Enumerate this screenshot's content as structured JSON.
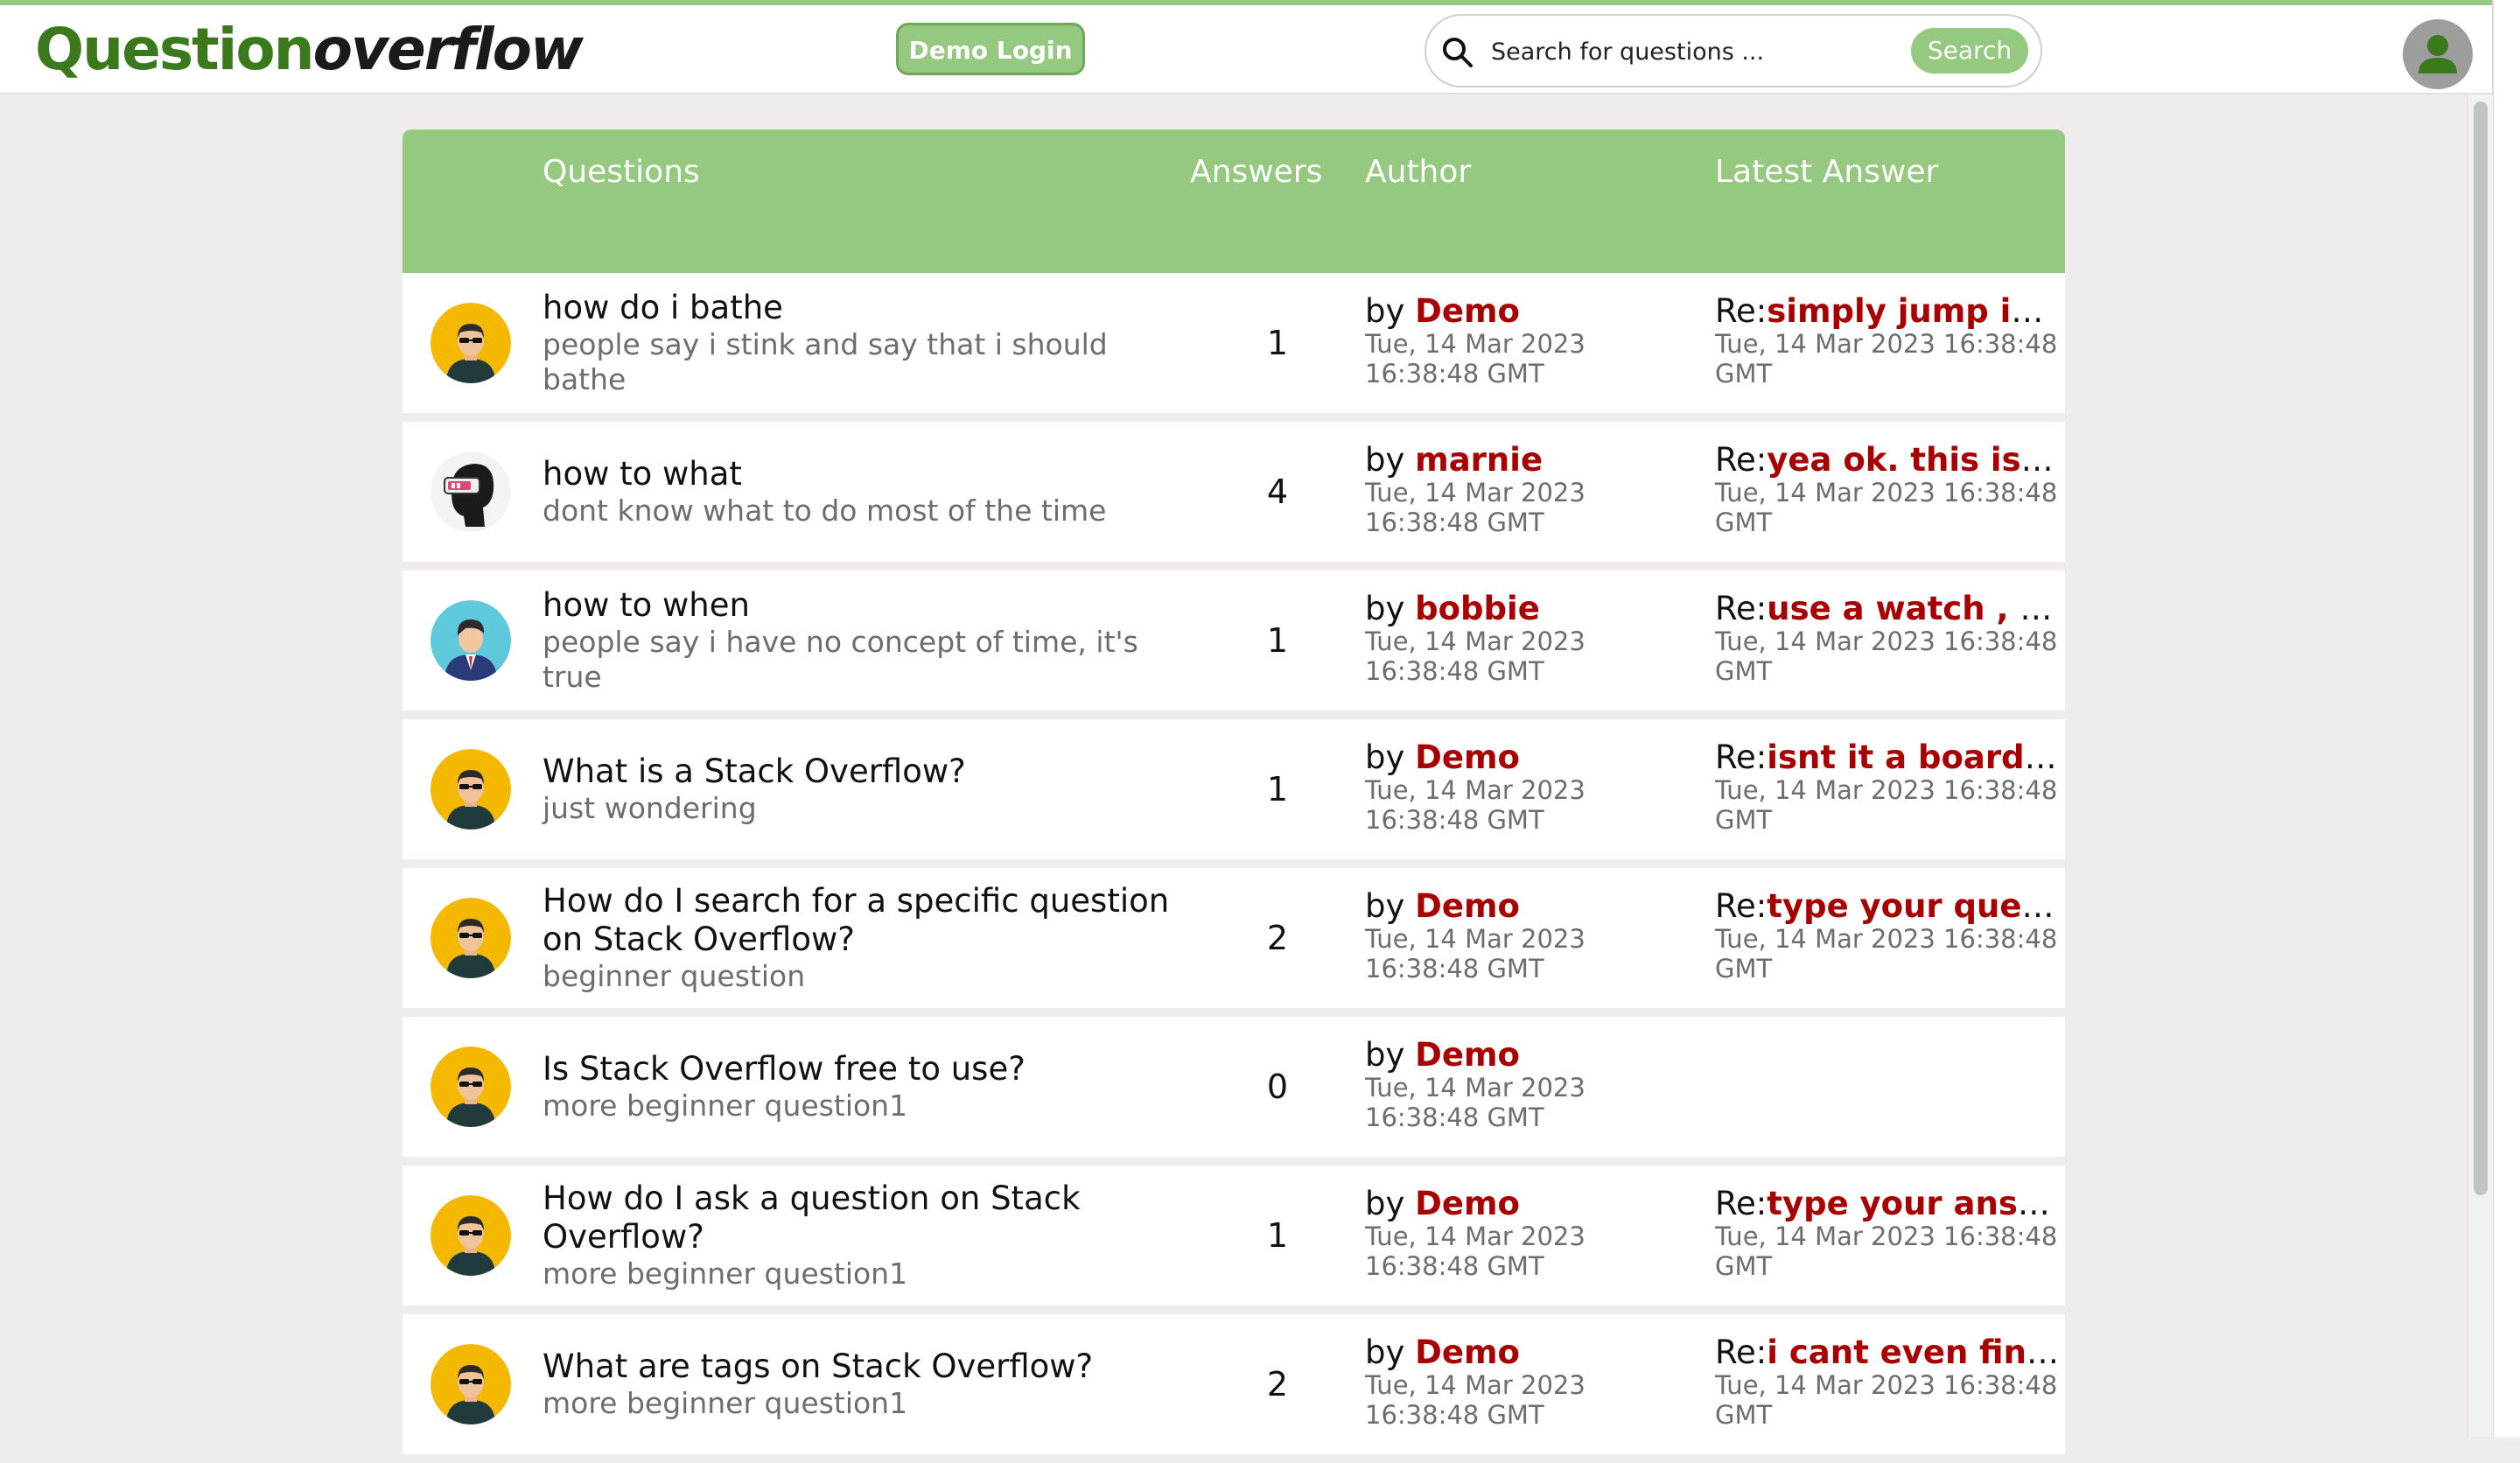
{
  "app": {
    "logo_part1": "Question",
    "logo_part2": "overflow",
    "demo_login_label": "Demo Login",
    "search_placeholder": "Search for questions ...",
    "search_button_label": "Search",
    "accent_color": "#94c97f",
    "link_color": "#a80000"
  },
  "table": {
    "headers": {
      "questions": "Questions",
      "answers": "Answers",
      "author": "Author",
      "latest": "Latest Answer"
    },
    "rows": [
      {
        "avatar": "sunglasses-avatar",
        "title": "how do i bathe",
        "description": "people say i stink and say that i should bathe",
        "answers": "1",
        "by": "by ",
        "author": "Demo",
        "author_time": "Tue, 14 Mar 2023 16:38:48 GMT",
        "re": "Re:",
        "latest": "simply jump insi...",
        "latest_time": "Tue, 14 Mar 2023 16:38:48 GMT"
      },
      {
        "avatar": "vr-head-avatar",
        "title": "how to what",
        "description": "dont know what to do most of the time",
        "answers": "4",
        "by": "by ",
        "author": "marnie",
        "author_time": "Tue, 14 Mar 2023 16:38:48 GMT",
        "re": "Re:",
        "latest": "yea ok. this is rig...",
        "latest_time": "Tue, 14 Mar 2023 16:38:48 GMT"
      },
      {
        "avatar": "businessman-avatar",
        "title": "how to when",
        "description": "people say i have no concept of time, it's true",
        "answers": "1",
        "by": "by ",
        "author": "bobbie",
        "author_time": "Tue, 14 Mar 2023 16:38:48 GMT",
        "re": "Re:",
        "latest": "use a watch , eas...",
        "latest_time": "Tue, 14 Mar 2023 16:38:48 GMT"
      },
      {
        "avatar": "sunglasses-avatar",
        "title": "What is a Stack Overflow?",
        "description": "just wondering",
        "answers": "1",
        "by": "by ",
        "author": "Demo",
        "author_time": "Tue, 14 Mar 2023 16:38:48 GMT",
        "re": "Re:",
        "latest": "isnt it a board ga...",
        "latest_time": "Tue, 14 Mar 2023 16:38:48 GMT"
      },
      {
        "avatar": "sunglasses-avatar",
        "title": "How do I search for a specific question on Stack Overflow?",
        "description": "beginner question",
        "answers": "2",
        "by": "by ",
        "author": "Demo",
        "author_time": "Tue, 14 Mar 2023 16:38:48 GMT",
        "re": "Re:",
        "latest": "type your questi...",
        "latest_time": "Tue, 14 Mar 2023 16:38:48 GMT"
      },
      {
        "avatar": "sunglasses-avatar",
        "title": "Is Stack Overflow free to use?",
        "description": "more beginner question1",
        "answers": "0",
        "by": "by ",
        "author": "Demo",
        "author_time": "Tue, 14 Mar 2023 16:38:48 GMT",
        "re": "",
        "latest": "",
        "latest_time": ""
      },
      {
        "avatar": "sunglasses-avatar",
        "title": "How do I ask a question on Stack Overflow?",
        "description": "more beginner question1",
        "answers": "1",
        "by": "by ",
        "author": "Demo",
        "author_time": "Tue, 14 Mar 2023 16:38:48 GMT",
        "re": "Re:",
        "latest": "type your answe...",
        "latest_time": "Tue, 14 Mar 2023 16:38:48 GMT"
      },
      {
        "avatar": "sunglasses-avatar",
        "title": "What are tags on Stack Overflow?",
        "description": "more beginner question1",
        "answers": "2",
        "by": "by ",
        "author": "Demo",
        "author_time": "Tue, 14 Mar 2023 16:38:48 GMT",
        "re": "Re:",
        "latest": "i cant even find t...",
        "latest_time": "Tue, 14 Mar 2023 16:38:48 GMT"
      }
    ]
  }
}
